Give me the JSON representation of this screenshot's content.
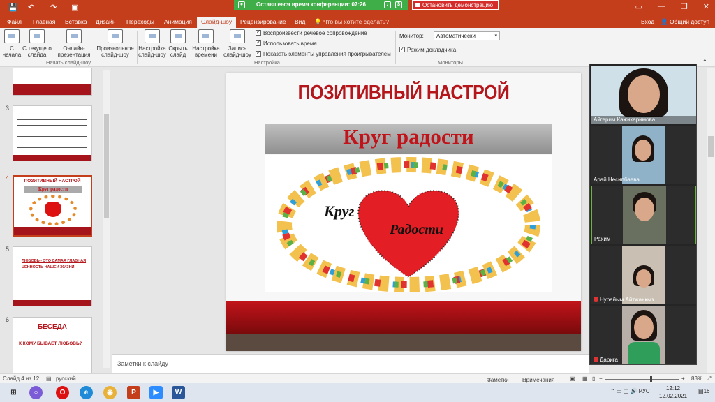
{
  "titlebar": {
    "conference_timer": "Оставшееся время конференции: 07:26",
    "stop_demo": "Остановить демонстрацию"
  },
  "tabs": [
    {
      "label": "Файл"
    },
    {
      "label": "Главная"
    },
    {
      "label": "Вставка"
    },
    {
      "label": "Дизайн"
    },
    {
      "label": "Переходы"
    },
    {
      "label": "Анимация"
    },
    {
      "label": "Слайд-шоу"
    },
    {
      "label": "Рецензирование"
    },
    {
      "label": "Вид"
    }
  ],
  "tell_me": "Что вы хотите сделать?",
  "login": "Вход",
  "share": "Общий доступ",
  "ribbon": {
    "from_start": "С начала",
    "from_current": "С текущего слайда",
    "online": "Онлайн-презентация",
    "custom": "Произвольное слайд-шоу",
    "group_start": "Начать слайд-шоу",
    "setup": "Настройка слайд-шоу",
    "hide": "Скрыть слайд",
    "timing": "Настройка времени",
    "record": "Запись слайд-шоу",
    "chk_narration": "Воспроизвести речевое сопровождение",
    "chk_timings": "Использовать время",
    "chk_controls": "Показать элементы управления проигрывателем",
    "group_setup": "Настройка",
    "monitor_label": "Монитор:",
    "monitor_value": "Автоматически",
    "presenter_view": "Режим докладчика",
    "group_monitors": "Мониторы"
  },
  "thumbnails": [
    {
      "num": "3"
    },
    {
      "num": "4",
      "title": "ПОЗИТИВНЫЙ НАСТРОЙ",
      "subtitle": "Круг радости"
    },
    {
      "num": "5",
      "text": "ЛЮБОВЬ - ЭТО САМАЯ ГЛАВНАЯ ЦЕННОСТЬ НАШЕЙ ЖИЗНИ"
    },
    {
      "num": "6",
      "title": "БЕСЕДА",
      "text": "К КОМУ БЫВАЕТ ЛЮБОВЬ?"
    }
  ],
  "slide": {
    "title": "ПОЗИТИВНЫЙ НАСТРОЙ",
    "subtitle": "Круг радости",
    "art_word1": "Круг",
    "art_word2": "Радости"
  },
  "notes_placeholder": "Заметки к слайду",
  "participants": [
    {
      "name": "Айгерим Кажикаримова"
    },
    {
      "name": "Арай Несипбаева"
    },
    {
      "name": "Рахим"
    },
    {
      "name": "Нурайым Айтжанкыз..."
    },
    {
      "name": "Дарига"
    }
  ],
  "status": {
    "slide_info": "Слайд 4 из 12",
    "language": "русский",
    "notes": "Заметки",
    "comments": "Примечания",
    "zoom": "83%"
  },
  "taskbar": {
    "lang": "РУС",
    "time": "12:12",
    "date": "12.02.2021",
    "notif": "16"
  }
}
